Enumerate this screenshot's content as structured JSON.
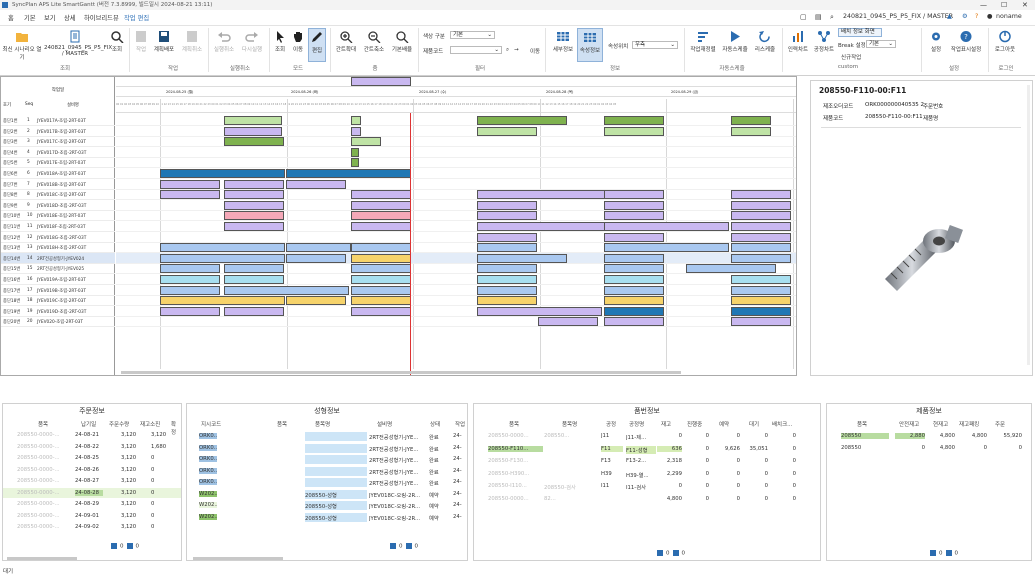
{
  "titlebar": {
    "text": "SyncPlan APS Lite SmartGantt (버전 7.3.8999, 빌드일시 2024-08-21 13:11)",
    "controls": [
      "—",
      "☐",
      "✕"
    ]
  },
  "menubar": {
    "items": [
      "홈",
      "기본",
      "보기",
      "상세",
      "하이브리드뷰",
      "작업 편집"
    ],
    "active_index": 5,
    "right": {
      "plan_name": "240821_0945_PS_P5_FIX / MASTER",
      "user": "noname"
    }
  },
  "ribbon": {
    "buttons": [
      {
        "id": "open-recent",
        "label": "최신 시나리오 열기"
      },
      {
        "id": "scenario",
        "label": "240821_0945_PS_P5_FIX / MASTER"
      },
      {
        "id": "lookup",
        "label": "조회"
      },
      {
        "id": "plan",
        "label": "작업"
      },
      {
        "id": "plan-deploy",
        "label": "계획배포"
      },
      {
        "id": "plan-cancel",
        "label": "계획취소"
      },
      {
        "id": "undo",
        "label": "실행취소"
      },
      {
        "id": "redo",
        "label": "다시실행"
      },
      {
        "id": "select",
        "label": "조회"
      },
      {
        "id": "move",
        "label": "이동"
      },
      {
        "id": "edit",
        "label": "편집"
      },
      {
        "id": "gantt-zoom-in",
        "label": "간트확대"
      },
      {
        "id": "gantt-zoom-out",
        "label": "간트축소"
      },
      {
        "id": "default-zoom",
        "label": "기본배율"
      },
      {
        "id": "detail-info",
        "label": "세부정보"
      },
      {
        "id": "attr-info",
        "label": "속성정보"
      },
      {
        "id": "reschedule",
        "label": "작업재정렬"
      },
      {
        "id": "auto-schedule",
        "label": "자동스케쥴"
      },
      {
        "id": "reschedule2",
        "label": "리스케줄"
      },
      {
        "id": "capacity-chart",
        "label": "인력차트"
      },
      {
        "id": "process-chart",
        "label": "공정차트"
      },
      {
        "id": "new-work",
        "label": "신규작업"
      },
      {
        "id": "settings",
        "label": "설정"
      },
      {
        "id": "work-display",
        "label": "작업표시설정"
      },
      {
        "id": "logout",
        "label": "로그아웃"
      }
    ],
    "group_labels": [
      "조회",
      "작업",
      "실행취소",
      "모드",
      "줌",
      "필터",
      "정보",
      "자동스케줄",
      "custom",
      "설정",
      "로그인"
    ],
    "filters": {
      "color_label": "색상 구분",
      "color_value": "기본",
      "product_code_label": "제품코드",
      "move_label": "이동",
      "sort_label": "속성위치",
      "sort_value": "우측"
    },
    "custom": {
      "batch_button": "배치 정보 화면",
      "break_label": "Break 설정",
      "break_value": "기본"
    }
  },
  "gantt": {
    "header_top": "작업일",
    "col_headers": [
      "호기",
      "Seq",
      "설비명"
    ],
    "date_labels": [
      "2024-08-25 (월)",
      "2024-08-26 (화)",
      "2024-08-27 (수)",
      "2024-08-28 (목)",
      "2024-08-29 (금)"
    ],
    "rows": [
      {
        "code": "종단1번",
        "seq": "1",
        "name": "JYEV017A-조립-2RT-03T"
      },
      {
        "code": "종단2번",
        "seq": "2",
        "name": "JYEV017B-조립-2RT-03T"
      },
      {
        "code": "종단3번",
        "seq": "3",
        "name": "JYEV017C-조립-2RT-03T"
      },
      {
        "code": "종단4번",
        "seq": "4",
        "name": "JYEV017D-조립-2RT-03T"
      },
      {
        "code": "종단5번",
        "seq": "5",
        "name": "JYEV017E-조립-2RT-03T"
      },
      {
        "code": "종단6번",
        "seq": "6",
        "name": "JYEV018A-조립-2RT-03T"
      },
      {
        "code": "종단7번",
        "seq": "7",
        "name": "JYEV018B-조립-2RT-03T"
      },
      {
        "code": "종단8번",
        "seq": "8",
        "name": "JYEV018C-조립-2RT-03T"
      },
      {
        "code": "종단9번",
        "seq": "9",
        "name": "JYEV018D-조립-2RT-03T"
      },
      {
        "code": "종단10번",
        "seq": "10",
        "name": "JYEV018E-조립-2RT-03T"
      },
      {
        "code": "종단11번",
        "seq": "11",
        "name": "JYEV018F-조립-2RT-03T"
      },
      {
        "code": "종단12번",
        "seq": "12",
        "name": "JYEV018G-조립-2RT-03T"
      },
      {
        "code": "종단13번",
        "seq": "13",
        "name": "JYEV018H-조립-2RT-03T"
      },
      {
        "code": "종단14번",
        "seq": "14",
        "name": "2RT전공성형기-JYEV024"
      },
      {
        "code": "종단15번",
        "seq": "15",
        "name": "2RT전공성형기-JYEV025"
      },
      {
        "code": "종단16번",
        "seq": "16",
        "name": "JYEV019A-조립-2RT-03T"
      },
      {
        "code": "종단17번",
        "seq": "17",
        "name": "JYEV019B-조립-2RT-03T"
      },
      {
        "code": "종단18번",
        "seq": "18",
        "name": "JYEV019C-조립-2RT-03T"
      },
      {
        "code": "종단19번",
        "seq": "19",
        "name": "JYEV019D-조립-2RT-03T"
      },
      {
        "code": "종단20번",
        "seq": "20",
        "name": "JYEV020-조립-2RT-03T"
      }
    ]
  },
  "product_detail": {
    "title": "208550-F110-00:F11",
    "fields": [
      {
        "label": "제조오더코드",
        "value": "ORK000000040535 2",
        "label2": "주문번호",
        "value2": ""
      },
      {
        "label": "제품코드",
        "value": "208550-F110-00:F11",
        "label2": "제품명",
        "value2": ""
      }
    ]
  },
  "order_pane": {
    "title": "주문정보",
    "headers": [
      "품목",
      "납기일",
      "주문수량",
      "재고소진",
      "확정"
    ],
    "rows": [
      {
        "item": "208550-0000-...",
        "due": "24-08-21",
        "qty": "3,120",
        "stock": "3,120",
        "fix": ""
      },
      {
        "item": "208550-0000-...",
        "due": "24-08-22",
        "qty": "3,120",
        "stock": "1,680",
        "fix": ""
      },
      {
        "item": "208550-0000-...",
        "due": "24-08-25",
        "qty": "3,120",
        "stock": "0",
        "fix": ""
      },
      {
        "item": "208550-0000-...",
        "due": "24-08-26",
        "qty": "3,120",
        "stock": "0",
        "fix": ""
      },
      {
        "item": "208550-0000-...",
        "due": "24-08-27",
        "qty": "3,120",
        "stock": "0",
        "fix": ""
      },
      {
        "item": "208550-0000-...",
        "due": "24-08-28",
        "qty": "3,120",
        "stock": "0",
        "fix": ""
      },
      {
        "item": "208550-0000-...",
        "due": "24-08-29",
        "qty": "3,120",
        "stock": "0",
        "fix": ""
      },
      {
        "item": "208550-0000-...",
        "due": "24-09-01",
        "qty": "3,120",
        "stock": "0",
        "fix": ""
      },
      {
        "item": "208550-0000-...",
        "due": "24-09-02",
        "qty": "3,120",
        "stock": "0",
        "fix": ""
      }
    ],
    "pager": {
      "a": "0",
      "b": "0"
    }
  },
  "molding_pane": {
    "title": "성형정보",
    "headers": [
      "지시코드",
      "품목",
      "품목명",
      "설비명",
      "상태",
      "작업"
    ],
    "rows": [
      {
        "code": "ORK0...",
        "item": "",
        "name": "",
        "equip": "2RT전공성형기-JYE...",
        "status": "완료",
        "w": "24-"
      },
      {
        "code": "ORK0...",
        "item": "",
        "name": "",
        "equip": "2RT전공성형기-JYE...",
        "status": "완료",
        "w": "24-"
      },
      {
        "code": "ORK0...",
        "item": "",
        "name": "",
        "equip": "2RT전공성형기-JYE...",
        "status": "완료",
        "w": "24-"
      },
      {
        "code": "ORK0...",
        "item": "",
        "name": "",
        "equip": "2RT전공성형기-JYE...",
        "status": "완료",
        "w": "24-"
      },
      {
        "code": "ORK0...",
        "item": "",
        "name": "",
        "equip": "2RT전공성형기-JYE...",
        "status": "완료",
        "w": "24-"
      },
      {
        "code": "W202...",
        "item": "",
        "name": "208550-성형",
        "equip": "JYEV018C-오링-2R...",
        "status": "예약",
        "w": "24-"
      },
      {
        "code": "W202...",
        "item": "",
        "name": "208550-성형",
        "equip": "JYEV018C-오링-2R...",
        "status": "예약",
        "w": "24-"
      },
      {
        "code": "W202...",
        "item": "",
        "name": "208550-성형",
        "equip": "JYEV018C-오링-2R...",
        "status": "예약",
        "w": "24-"
      }
    ],
    "pager": {
      "a": "0",
      "b": "0"
    }
  },
  "item_pane": {
    "title": "품번정보",
    "headers": [
      "품목",
      "품목명",
      "공정",
      "공정명",
      "재고",
      "진행중",
      "예약",
      "대기",
      "배치크..."
    ],
    "rows": [
      {
        "item": "208550-0000...",
        "name": "208550...",
        "proc": "J11",
        "pname": "J11-제...",
        "stock": "0",
        "prog": "0",
        "res": "0",
        "wait": "0",
        "batch": "0"
      },
      {
        "item": "208550-F110...",
        "name": "",
        "proc": "F11",
        "pname": "F11-성형",
        "stock": "636",
        "prog": "0",
        "res": "9,626",
        "wait": "35,051",
        "batch": "0"
      },
      {
        "item": "208550-F130...",
        "name": "",
        "proc": "F13",
        "pname": "F13-2...",
        "stock": "2,318",
        "prog": "0",
        "res": "0",
        "wait": "0",
        "batch": "0"
      },
      {
        "item": "208550-H390...",
        "name": "",
        "proc": "H39",
        "pname": "H39-열...",
        "stock": "2,299",
        "prog": "0",
        "res": "0",
        "wait": "0",
        "batch": "0"
      },
      {
        "item": "208550-I110...",
        "name": "208550-검사",
        "proc": "I11",
        "pname": "I11-검사",
        "stock": "0",
        "prog": "0",
        "res": "0",
        "wait": "0",
        "batch": "0"
      },
      {
        "item": "208550-0000...",
        "name": "82...",
        "proc": "",
        "pname": "",
        "stock": "4,800",
        "prog": "0",
        "res": "0",
        "wait": "0",
        "batch": "0"
      }
    ],
    "pager": {
      "a": "0",
      "b": "0"
    }
  },
  "product_pane": {
    "title": "제품정보",
    "headers": [
      "품목",
      "안전재고",
      "현재고",
      "재고패킹",
      "주문"
    ],
    "rows": [
      {
        "item": "208550",
        "safety": "2,880",
        "stock": "4,800",
        "pack": "4,800",
        "order": "55,920"
      },
      {
        "item": "208550",
        "safety": "0",
        "stock": "4,800",
        "pack": "0",
        "order": "0"
      }
    ],
    "pager": {
      "a": "0",
      "b": "0"
    }
  },
  "statusbar": {
    "text": "대기"
  }
}
